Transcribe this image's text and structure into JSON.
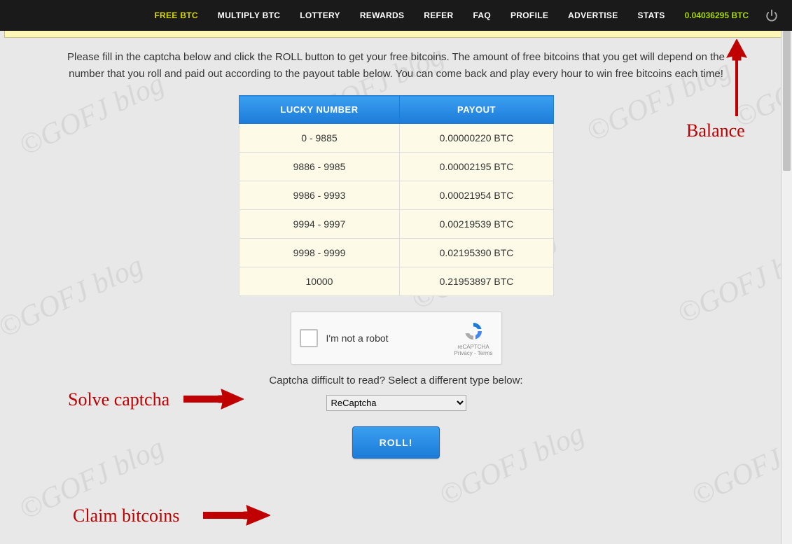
{
  "nav": {
    "items": [
      {
        "label": "FREE BTC",
        "active": true
      },
      {
        "label": "MULTIPLY BTC"
      },
      {
        "label": "LOTTERY"
      },
      {
        "label": "REWARDS"
      },
      {
        "label": "REFER"
      },
      {
        "label": "FAQ"
      },
      {
        "label": "PROFILE"
      },
      {
        "label": "ADVERTISE"
      },
      {
        "label": "STATS"
      }
    ],
    "balance": "0.04036295 BTC"
  },
  "intro": "Please fill in the captcha below and click the ROLL button to get your free bitcoins. The amount of free bitcoins that you get will depend on the number that you roll and paid out according to the payout table below. You can come back and play every hour to win free bitcoins each time!",
  "table": {
    "headers": {
      "lucky": "LUCKY NUMBER",
      "payout": "PAYOUT"
    },
    "rows": [
      {
        "range": "0 - 9885",
        "payout": "0.00000220 BTC"
      },
      {
        "range": "9886 - 9985",
        "payout": "0.00002195 BTC"
      },
      {
        "range": "9986 - 9993",
        "payout": "0.00021954 BTC"
      },
      {
        "range": "9994 - 9997",
        "payout": "0.00219539 BTC"
      },
      {
        "range": "9998 - 9999",
        "payout": "0.02195390 BTC"
      },
      {
        "range": "10000",
        "payout": "0.21953897 BTC"
      }
    ]
  },
  "captcha": {
    "label": "I'm not a robot",
    "brand": "reCAPTCHA",
    "privacy": "Privacy",
    "terms": "Terms",
    "hint": "Captcha difficult to read? Select a different type below:",
    "select_value": "ReCaptcha"
  },
  "roll_label": "ROLL!",
  "annotations": {
    "balance": "Balance",
    "solve": "Solve captcha",
    "claim": "Claim bitcoins"
  },
  "watermark_text": "©GOFJ blog"
}
